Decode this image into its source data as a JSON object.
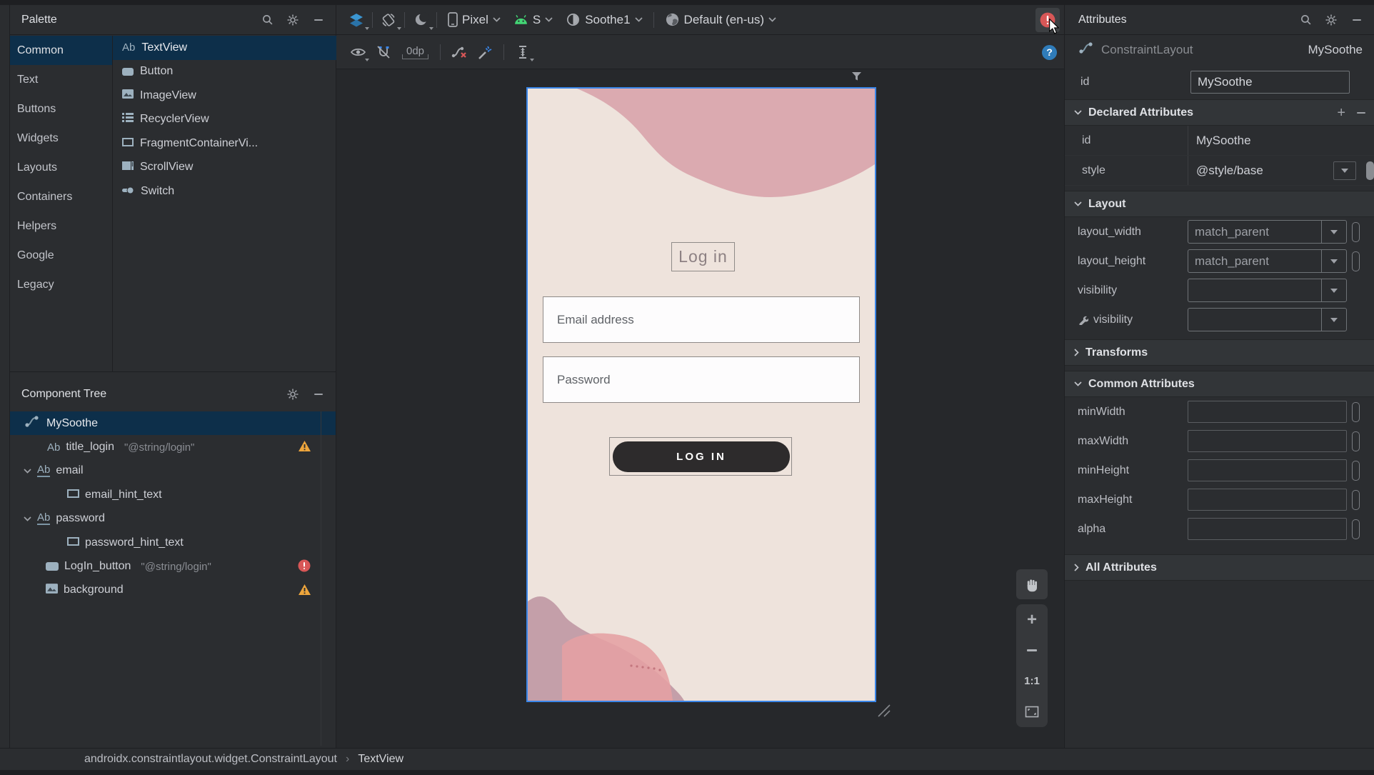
{
  "palette": {
    "title": "Palette",
    "categories": [
      "Common",
      "Text",
      "Buttons",
      "Widgets",
      "Layouts",
      "Containers",
      "Helpers",
      "Google",
      "Legacy"
    ],
    "selected_category": "Common",
    "items": [
      {
        "icon": "textview-icon",
        "label": "TextView"
      },
      {
        "icon": "button-icon",
        "label": "Button"
      },
      {
        "icon": "imageview-icon",
        "label": "ImageView"
      },
      {
        "icon": "recyclerview-icon",
        "label": "RecyclerView"
      },
      {
        "icon": "fragmentcontainerview-icon",
        "label": "FragmentContainerVi..."
      },
      {
        "icon": "scrollview-icon",
        "label": "ScrollView"
      },
      {
        "icon": "switch-icon",
        "label": "Switch"
      }
    ],
    "selected_item": "TextView"
  },
  "component_tree": {
    "title": "Component Tree",
    "rows": [
      {
        "label": "MySoothe",
        "icon": "constraint-layout-icon",
        "selected": true
      },
      {
        "label": "title_login",
        "value": "\"@string/login\"",
        "icon": "textview-icon",
        "badge": "warning"
      },
      {
        "label": "email",
        "icon": "textview-icon",
        "expanded": true
      },
      {
        "label": "email_hint_text",
        "icon": "view-icon"
      },
      {
        "label": "password",
        "icon": "textview-icon",
        "expanded": true
      },
      {
        "label": "password_hint_text",
        "icon": "view-icon"
      },
      {
        "label": "LogIn_button",
        "value": "\"@string/login\"",
        "icon": "button-icon",
        "badge": "error"
      },
      {
        "label": "background",
        "icon": "imageview-icon",
        "badge": "warning"
      }
    ]
  },
  "toolbar": {
    "device": "Pixel",
    "api": "S",
    "theme": "Soothe1",
    "locale": "Default (en-us)",
    "margin": "0dp"
  },
  "canvas": {
    "title": "Log in",
    "email_hint": "Email address",
    "password_hint": "Password",
    "login_button": "LOG IN",
    "zoom_label": "1:1"
  },
  "attributes": {
    "title": "Attributes",
    "component": "ConstraintLayout",
    "component_id": "MySoothe",
    "id_label": "id",
    "id_value": "MySoothe",
    "sections": {
      "declared": "Declared Attributes",
      "layout": "Layout",
      "transforms": "Transforms",
      "common": "Common Attributes",
      "all": "All Attributes"
    },
    "declared_rows": [
      {
        "name": "id",
        "value": "MySoothe"
      },
      {
        "name": "style",
        "value": "@style/base"
      }
    ],
    "layout_rows": [
      {
        "name": "layout_width",
        "value": "match_parent"
      },
      {
        "name": "layout_height",
        "value": "match_parent"
      },
      {
        "name": "visibility",
        "value": ""
      },
      {
        "name": "visibility",
        "value": "",
        "tool_attribute": true
      }
    ],
    "common_rows": [
      {
        "name": "minWidth",
        "value": ""
      },
      {
        "name": "maxWidth",
        "value": ""
      },
      {
        "name": "minHeight",
        "value": ""
      },
      {
        "name": "maxHeight",
        "value": ""
      },
      {
        "name": "alpha",
        "value": ""
      }
    ]
  },
  "statusbar": {
    "breadcrumb": [
      "androidx.constraintlayout.widget.ConstraintLayout",
      "TextView"
    ],
    "separator": "›"
  },
  "colors": {
    "accent_blue": "#3a86e8",
    "selection": "#0d2f4a",
    "error_red": "#d85757",
    "warning_orange": "#eda53c",
    "android_green": "#43d675",
    "layers_blue": "#3b96d2",
    "canvas_cream": "#eee3dc",
    "blob_pink": "#dbaab0",
    "blob_mauve": "#c49fa9",
    "blob_bright_pink": "#e5a0a3",
    "button_dark": "#2d2b2c",
    "help_blue": "#2f7cba"
  }
}
